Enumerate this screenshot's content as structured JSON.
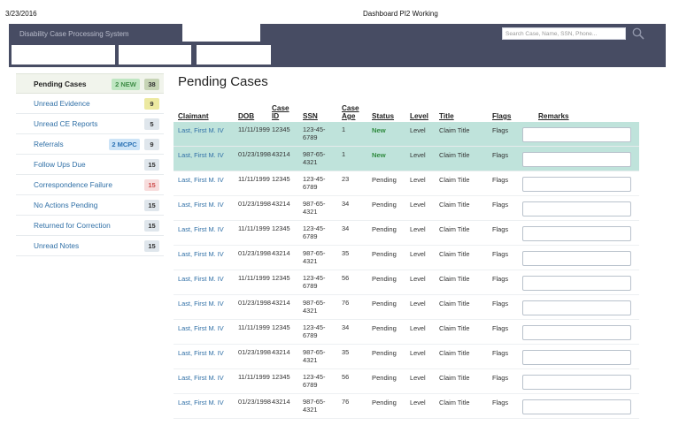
{
  "print_header": {
    "date": "3/23/2016",
    "title": "Dashboard PI2 Working"
  },
  "app": {
    "name": "Disability Case Processing System"
  },
  "search": {
    "placeholder": "Search Case, Name, SSN, Phone...",
    "icon": "search-icon"
  },
  "colors": {
    "header_bg": "#474c63",
    "link": "#2f6fa6",
    "highlight_row": "#bfe3db",
    "new_status": "#2e8a3e"
  },
  "sidebar": {
    "items": [
      {
        "label": "Pending Cases",
        "tag": "2 NEW",
        "count": "38"
      },
      {
        "label": "Unread Evidence",
        "count": "9"
      },
      {
        "label": "Unread CE Reports",
        "count": "5"
      },
      {
        "label": "Referrals",
        "tag": "2 MCPC",
        "count": "9"
      },
      {
        "label": "Follow Ups Due",
        "count": "15"
      },
      {
        "label": "Correspondence Failure",
        "count": "15"
      },
      {
        "label": "No Actions Pending",
        "count": "15"
      },
      {
        "label": "Returned for Correction",
        "count": "15"
      },
      {
        "label": "Unread Notes",
        "count": "15"
      }
    ]
  },
  "main": {
    "title": "Pending Cases",
    "columns": [
      "Claimant",
      "DOB",
      "Case ID",
      "SSN",
      "Case Age",
      "Status",
      "Level",
      "Title",
      "Flags",
      "Remarks"
    ],
    "rows": [
      {
        "claimant": "Last, First M. IV",
        "dob": "11/11/1999",
        "case_id": "12345",
        "ssn": "123-45-6789",
        "age": "1",
        "status": "New",
        "level": "Level",
        "title": "Claim Title",
        "flags": "Flags"
      },
      {
        "claimant": "Last, First M. IV",
        "dob": "01/23/1998",
        "case_id": "43214",
        "ssn": "987-65-4321",
        "age": "1",
        "status": "New",
        "level": "Level",
        "title": "Claim Title",
        "flags": "Flags"
      },
      {
        "claimant": "Last, First M. IV",
        "dob": "11/11/1999",
        "case_id": "12345",
        "ssn": "123-45-6789",
        "age": "23",
        "status": "Pending",
        "level": "Level",
        "title": "Claim Title",
        "flags": "Flags"
      },
      {
        "claimant": "Last, First M. IV",
        "dob": "01/23/1998",
        "case_id": "43214",
        "ssn": "987-65-4321",
        "age": "34",
        "status": "Pending",
        "level": "Level",
        "title": "Claim Title",
        "flags": "Flags"
      },
      {
        "claimant": "Last, First M. IV",
        "dob": "11/11/1999",
        "case_id": "12345",
        "ssn": "123-45-6789",
        "age": "34",
        "status": "Pending",
        "level": "Level",
        "title": "Claim Title",
        "flags": "Flags"
      },
      {
        "claimant": "Last, First M. IV",
        "dob": "01/23/1998",
        "case_id": "43214",
        "ssn": "987-65-4321",
        "age": "35",
        "status": "Pending",
        "level": "Level",
        "title": "Claim Title",
        "flags": "Flags"
      },
      {
        "claimant": "Last, First M. IV",
        "dob": "11/11/1999",
        "case_id": "12345",
        "ssn": "123-45-6789",
        "age": "56",
        "status": "Pending",
        "level": "Level",
        "title": "Claim Title",
        "flags": "Flags"
      },
      {
        "claimant": "Last, First M. IV",
        "dob": "01/23/1998",
        "case_id": "43214",
        "ssn": "987-65-4321",
        "age": "76",
        "status": "Pending",
        "level": "Level",
        "title": "Claim Title",
        "flags": "Flags"
      },
      {
        "claimant": "Last, First M. IV",
        "dob": "11/11/1999",
        "case_id": "12345",
        "ssn": "123-45-6789",
        "age": "34",
        "status": "Pending",
        "level": "Level",
        "title": "Claim Title",
        "flags": "Flags"
      },
      {
        "claimant": "Last, First M. IV",
        "dob": "01/23/1998",
        "case_id": "43214",
        "ssn": "987-65-4321",
        "age": "35",
        "status": "Pending",
        "level": "Level",
        "title": "Claim Title",
        "flags": "Flags"
      },
      {
        "claimant": "Last, First M. IV",
        "dob": "11/11/1999",
        "case_id": "12345",
        "ssn": "123-45-6789",
        "age": "56",
        "status": "Pending",
        "level": "Level",
        "title": "Claim Title",
        "flags": "Flags"
      },
      {
        "claimant": "Last, First M. IV",
        "dob": "01/23/1998",
        "case_id": "43214",
        "ssn": "987-65-4321",
        "age": "76",
        "status": "Pending",
        "level": "Level",
        "title": "Claim Title",
        "flags": "Flags"
      }
    ]
  }
}
